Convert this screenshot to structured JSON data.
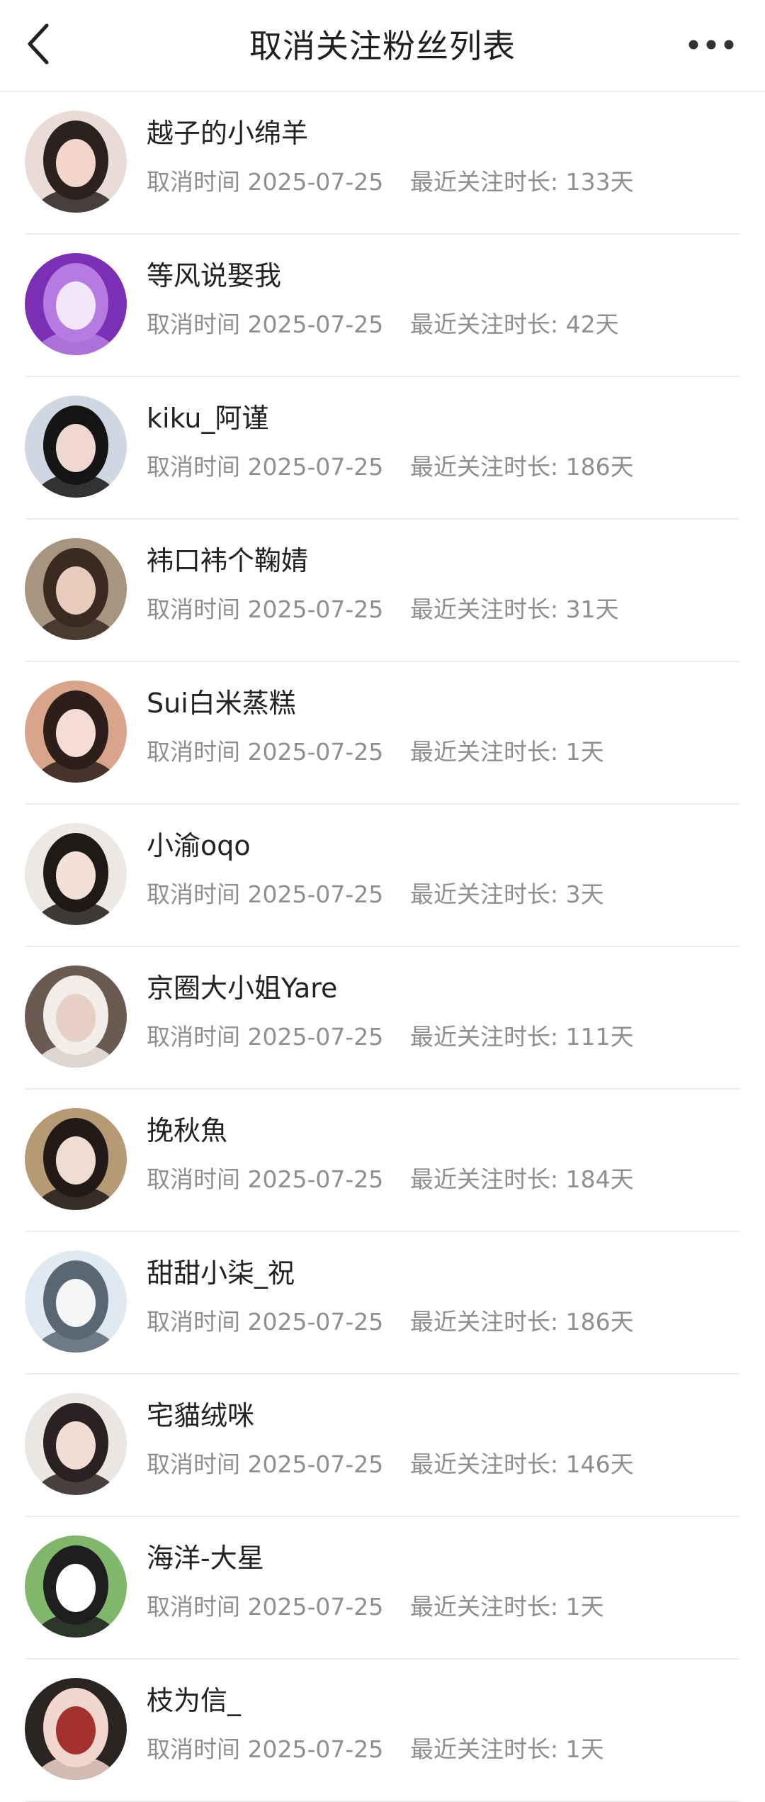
{
  "header": {
    "title": "取消关注粉丝列表"
  },
  "labels": {
    "cancel_time_prefix": "取消时间",
    "duration_prefix": "最近关注时长: "
  },
  "fans": [
    {
      "name": "越子的小绵羊",
      "cancel_date": "2025-07-25",
      "duration": "133天",
      "avatar_colors": [
        "#e9dcd6",
        "#2b2220",
        "#f3d6cb"
      ]
    },
    {
      "name": "等风说娶我",
      "cancel_date": "2025-07-25",
      "duration": "42天",
      "avatar_colors": [
        "#7a2fb5",
        "#b57be0",
        "#f2e6fb"
      ]
    },
    {
      "name": "kiku_阿谨",
      "cancel_date": "2025-07-25",
      "duration": "186天",
      "avatar_colors": [
        "#cfd7e2",
        "#151515",
        "#eed8cf"
      ]
    },
    {
      "name": "袆口袆个鞠婧",
      "cancel_date": "2025-07-25",
      "duration": "31天",
      "avatar_colors": [
        "#a8957f",
        "#3a2a22",
        "#e7cbbd"
      ]
    },
    {
      "name": "Sui白米蒸糕",
      "cancel_date": "2025-07-25",
      "duration": "1天",
      "avatar_colors": [
        "#d9a58a",
        "#2c1f1b",
        "#f6dcd2"
      ]
    },
    {
      "name": "小渝oqo",
      "cancel_date": "2025-07-25",
      "duration": "3天",
      "avatar_colors": [
        "#ece8e4",
        "#1e1a18",
        "#f3e0d8"
      ]
    },
    {
      "name": "京圈大小姐Yare",
      "cancel_date": "2025-07-25",
      "duration": "111天",
      "avatar_colors": [
        "#6b5a52",
        "#f2ede8",
        "#e6cfc4"
      ]
    },
    {
      "name": "挽秋魚",
      "cancel_date": "2025-07-25",
      "duration": "184天",
      "avatar_colors": [
        "#b59a75",
        "#221a17",
        "#f0ddd2"
      ]
    },
    {
      "name": "甜甜小柒_祝",
      "cancel_date": "2025-07-25",
      "duration": "186天",
      "avatar_colors": [
        "#dfe9f1",
        "#5a6672",
        "#f4f6f8"
      ]
    },
    {
      "name": "宅貓绒咪",
      "cancel_date": "2025-07-25",
      "duration": "146天",
      "avatar_colors": [
        "#e9e6e3",
        "#2a2222",
        "#f1dcd6"
      ]
    },
    {
      "name": "海洋-大星",
      "cancel_date": "2025-07-25",
      "duration": "1天",
      "avatar_colors": [
        "#7fb86b",
        "#1e1e1e",
        "#ffffff"
      ]
    },
    {
      "name": "枝为信_",
      "cancel_date": "2025-07-25",
      "duration": "1天",
      "avatar_colors": [
        "#2a2523",
        "#f0d6cc",
        "#a3322e"
      ]
    }
  ]
}
